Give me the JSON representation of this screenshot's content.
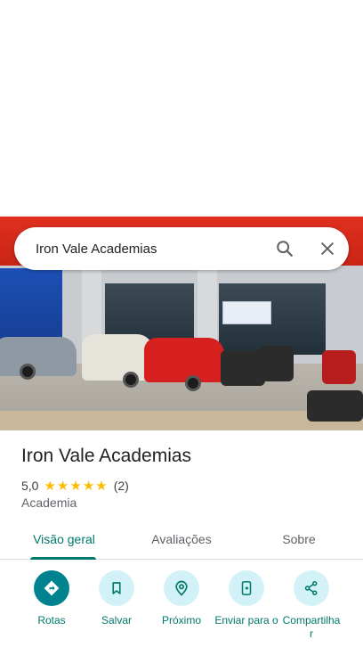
{
  "search": {
    "query": "Iron Vale Academias",
    "search_icon": "search-icon",
    "close_icon": "close-icon"
  },
  "place": {
    "name": "Iron Vale Academias",
    "rating": "5,0",
    "stars": 5,
    "review_count": "(2)",
    "category": "Academia"
  },
  "tabs": [
    {
      "label": "Visão geral",
      "active": true
    },
    {
      "label": "Avaliações",
      "active": false
    },
    {
      "label": "Sobre",
      "active": false
    }
  ],
  "actions": [
    {
      "label": "Rotas",
      "icon": "directions-icon"
    },
    {
      "label": "Salvar",
      "icon": "bookmark-icon"
    },
    {
      "label": "Próximo",
      "icon": "nearby-icon"
    },
    {
      "label": "Enviar para o",
      "icon": "send-to-phone-icon"
    },
    {
      "label": "Compartilha r",
      "icon": "share-icon"
    }
  ],
  "colors": {
    "accent": "#00796b",
    "primary_action": "#00838f",
    "action_bg": "#d3f2f8",
    "star": "#fbbc04"
  }
}
